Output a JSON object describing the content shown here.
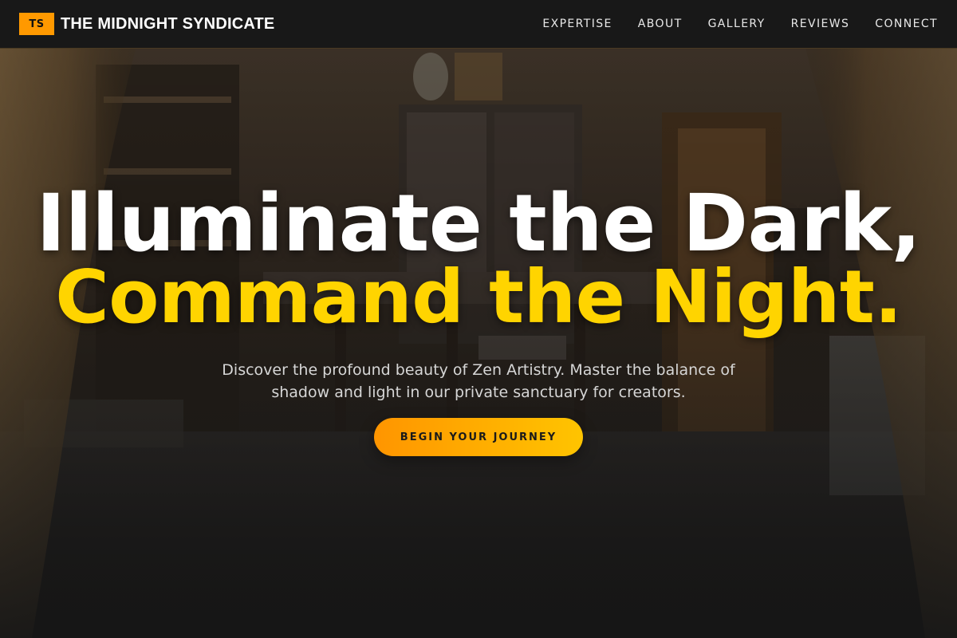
{
  "header": {
    "logo_text": "TS",
    "brand_name": "THE MIDNIGHT SYNDICATE",
    "nav": [
      {
        "label": "EXPERTISE"
      },
      {
        "label": "ABOUT"
      },
      {
        "label": "GALLERY"
      },
      {
        "label": "REVIEWS"
      },
      {
        "label": "CONNECT"
      }
    ]
  },
  "hero": {
    "headline_line1": "Illuminate the Dark,",
    "headline_line2": "Command the Night.",
    "subtext": "Discover the profound beauty of Zen Artistry. Master the balance of shadow and light in our private sanctuary for creators.",
    "cta_label": "BEGIN YOUR JOURNEY"
  },
  "colors": {
    "accent_orange": "#ff9900",
    "headline_yellow": "#ffd400",
    "header_bg": "#181818"
  }
}
